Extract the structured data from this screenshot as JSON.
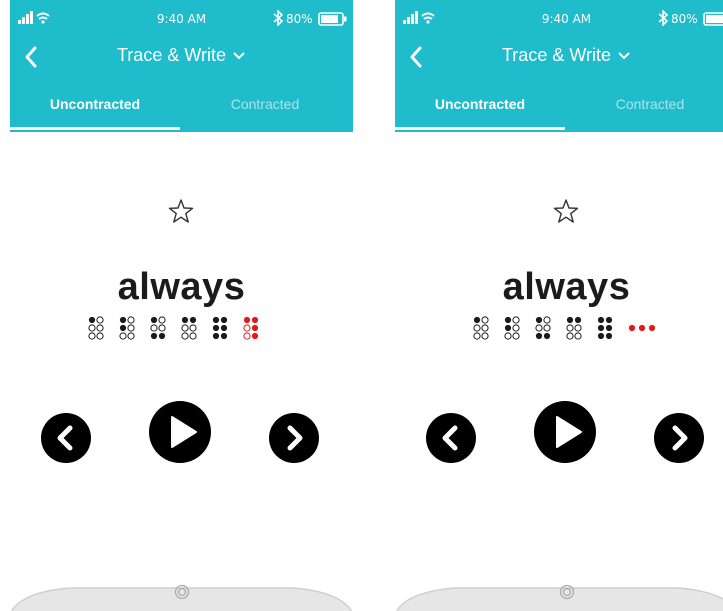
{
  "colors": {
    "header": "#1fbccb",
    "dot_filled": "#1b1b1b",
    "dot_highlight": "#e01b1b",
    "tab_inactive": "#a8e6ec"
  },
  "screens": [
    {
      "status": {
        "time": "9:40 AM",
        "battery": "80%"
      },
      "nav": {
        "title": "Trace & Write"
      },
      "tabs": [
        "Uncontracted",
        "Contracted"
      ],
      "word": "always",
      "braille_cells": [
        [
          1,
          0,
          0,
          0,
          0,
          0
        ],
        [
          1,
          1,
          0,
          0,
          0,
          0
        ],
        [
          1,
          0,
          1,
          0,
          0,
          1
        ],
        [
          1,
          0,
          0,
          1,
          0,
          0
        ],
        [
          1,
          1,
          1,
          1,
          1,
          1
        ],
        [
          0,
          0,
          0,
          0,
          0,
          0
        ]
      ],
      "highlight_cell": 5,
      "highlight_mode": "cell"
    },
    {
      "status": {
        "time": "9:40 AM",
        "battery": "80%"
      },
      "nav": {
        "title": "Trace & Write"
      },
      "tabs": [
        "Uncontracted",
        "Contracted"
      ],
      "word": "always",
      "braille_cells": [
        [
          1,
          0,
          0,
          0,
          0,
          0
        ],
        [
          1,
          1,
          0,
          0,
          0,
          0
        ],
        [
          1,
          0,
          1,
          0,
          0,
          1
        ],
        [
          1,
          0,
          0,
          1,
          0,
          0
        ],
        [
          1,
          1,
          1,
          1,
          1,
          1
        ],
        [
          0,
          0,
          0,
          0,
          0,
          0
        ]
      ],
      "highlight_cell": 5,
      "highlight_mode": "row"
    }
  ]
}
